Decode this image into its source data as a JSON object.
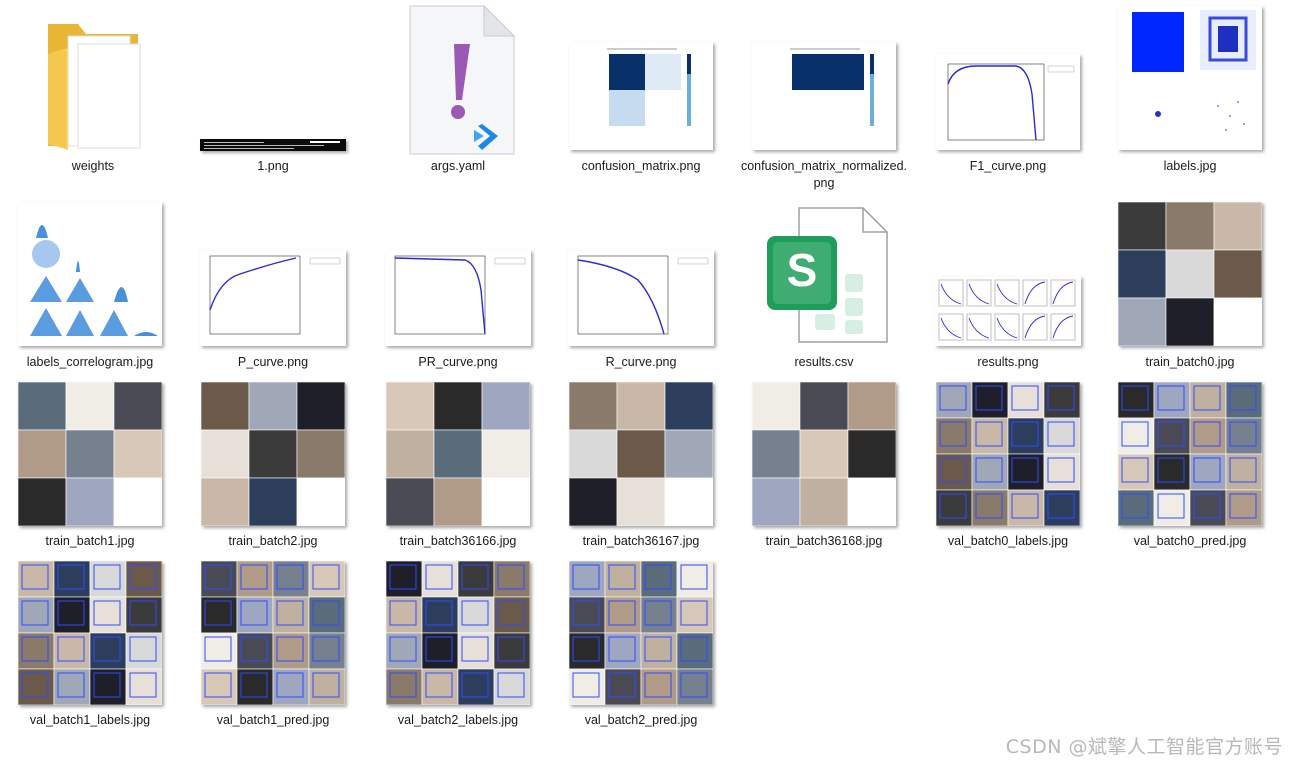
{
  "explorer": {
    "files": [
      {
        "name": "weights",
        "kind": "folder"
      },
      {
        "name": "1.png",
        "kind": "terminal"
      },
      {
        "name": "args.yaml",
        "kind": "yaml"
      },
      {
        "name": "confusion_matrix.png",
        "kind": "cm"
      },
      {
        "name": "confusion_matrix_normalized.png",
        "kind": "cmn"
      },
      {
        "name": "F1_curve.png",
        "kind": "curve"
      },
      {
        "name": "labels.jpg",
        "kind": "labels"
      },
      {
        "name": "labels_correlogram.jpg",
        "kind": "correlogram"
      },
      {
        "name": "P_curve.png",
        "kind": "curve"
      },
      {
        "name": "PR_curve.png",
        "kind": "prcurve"
      },
      {
        "name": "R_curve.png",
        "kind": "rcurve"
      },
      {
        "name": "results.csv",
        "kind": "csv"
      },
      {
        "name": "results.png",
        "kind": "results"
      },
      {
        "name": "train_batch0.jpg",
        "kind": "mosaic"
      },
      {
        "name": "train_batch1.jpg",
        "kind": "mosaic"
      },
      {
        "name": "train_batch2.jpg",
        "kind": "mosaic"
      },
      {
        "name": "train_batch36166.jpg",
        "kind": "mosaic"
      },
      {
        "name": "train_batch36167.jpg",
        "kind": "mosaic"
      },
      {
        "name": "train_batch36168.jpg",
        "kind": "mosaic"
      },
      {
        "name": "val_batch0_labels.jpg",
        "kind": "valmosaic"
      },
      {
        "name": "val_batch0_pred.jpg",
        "kind": "valmosaic"
      },
      {
        "name": "val_batch1_labels.jpg",
        "kind": "valmosaic"
      },
      {
        "name": "val_batch1_pred.jpg",
        "kind": "valmosaic"
      },
      {
        "name": "val_batch2_labels.jpg",
        "kind": "valmosaic"
      },
      {
        "name": "val_batch2_pred.jpg",
        "kind": "valmosaic"
      }
    ]
  },
  "watermark": "CSDN @斌擎人工智能官方账号",
  "colors": {
    "folder": "#f3c64b",
    "folder_front": "#f9d36a",
    "yaml_mark": "#9b59b6",
    "vscode": "#1e88e5",
    "csv": "#1e9e5a",
    "curve": "#2a2ad6",
    "cm_dark": "#08306b",
    "cm_light": "#deebf7"
  }
}
